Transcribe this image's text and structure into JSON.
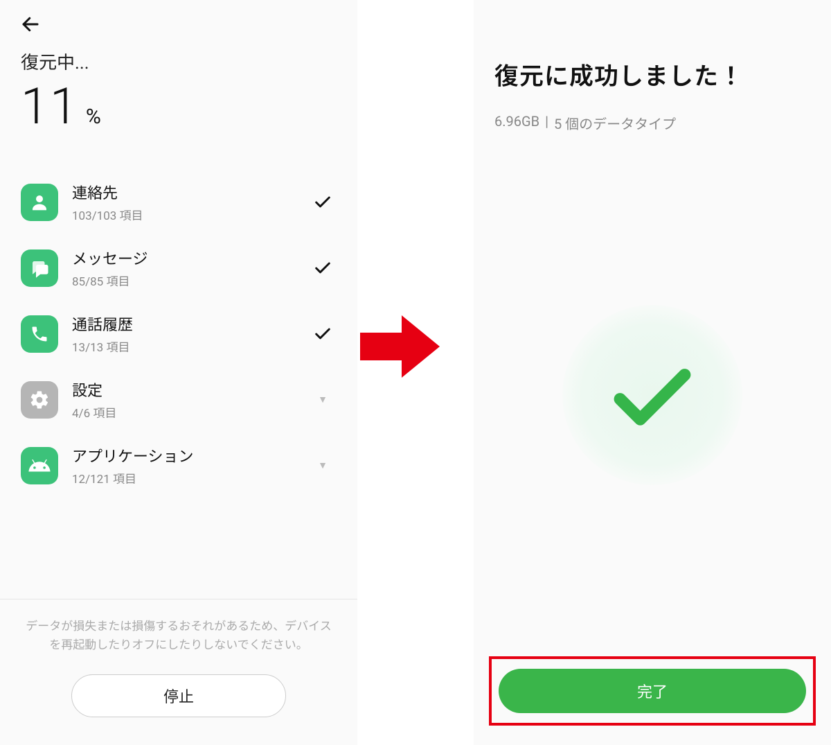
{
  "left": {
    "status_label": "復元中...",
    "percent_value": "11",
    "percent_symbol": "%",
    "items": [
      {
        "icon": "contacts-icon",
        "title": "連絡先",
        "sub": "103/103 項目",
        "state": "done"
      },
      {
        "icon": "messages-icon",
        "title": "メッセージ",
        "sub": "85/85 項目",
        "state": "done"
      },
      {
        "icon": "phone-icon",
        "title": "通話履歴",
        "sub": "13/13 項目",
        "state": "done"
      },
      {
        "icon": "settings-icon",
        "title": "設定",
        "sub": "4/6 項目",
        "state": "expand"
      },
      {
        "icon": "android-icon",
        "title": "アプリケーション",
        "sub": "12/121 項目",
        "state": "expand"
      }
    ],
    "warning": "データが損失または損傷するおそれがあるため、デバイスを再起動したりオフにしたりしないでください。",
    "stop_label": "停止"
  },
  "right": {
    "title": "復元に成功しました！",
    "size": "6.96GB",
    "sep": " | ",
    "types": "5 個のデータタイプ",
    "done_label": "完了"
  }
}
